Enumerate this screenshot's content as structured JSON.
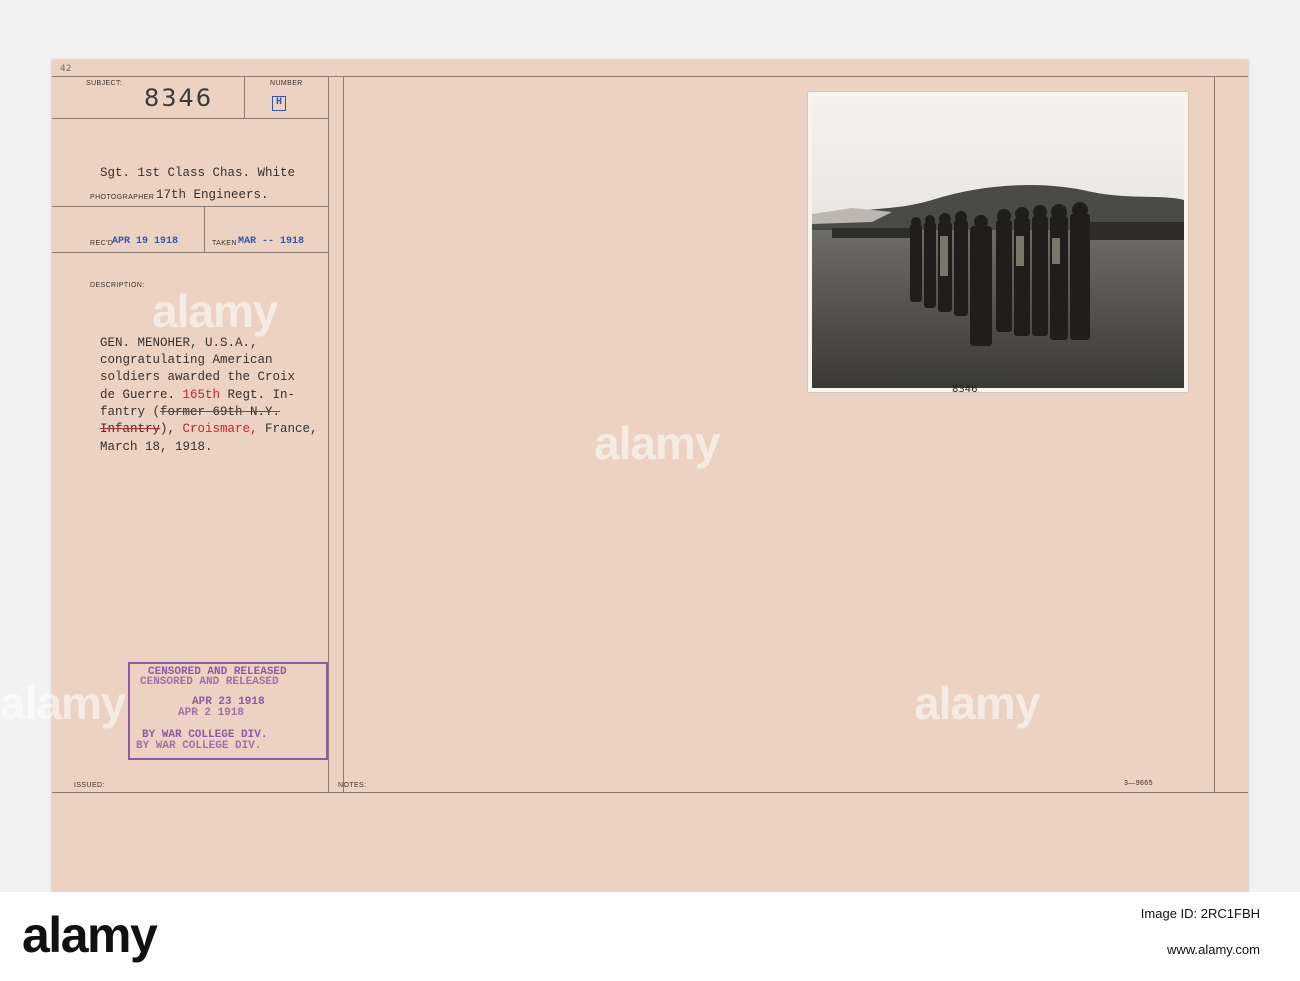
{
  "card": {
    "corner_note": "42",
    "subject_label": "SUBJECT:",
    "subject_value": "8346",
    "number_label": "NUMBER",
    "number_value": "H",
    "photographer_line1": "Sgt. 1st Class Chas. White",
    "photographer_label": "PHOTOGRAPHER",
    "photographer_line2": "17th Engineers.",
    "recd_label": "REC'D",
    "recd_date": "APR 19 1918",
    "taken_label": "TAKEN",
    "taken_date": "MAR -- 1918",
    "description_label": "DESCRIPTION:",
    "description": {
      "l1": "GEN. MENOHER, U.S.A.,",
      "l2": "congratulating American",
      "l3": "soldiers awarded the Croix",
      "l4_pre": "de Guerre. ",
      "l4_red": "165th",
      "l4_post": " Regt. In-",
      "l5_pre": "fantry (",
      "l5_strike": "former 69th N.Y.",
      "l6_strike": "Infantry",
      "l6_mid": "), ",
      "l6_red": "Croismare,",
      "l6_post": " France,",
      "l7": "March 18, 1918."
    },
    "stamp": {
      "line1": "CENSORED AND RELEASED",
      "line2": "CENSORED AND RELEASED",
      "line3": "APR 23 1918",
      "line4": "APR 2 1918",
      "line5": "BY WAR COLLEGE DIV.",
      "line6": "BY WAR COLLEGE DIV."
    },
    "issued_label": "ISSUED:",
    "notes_label": "NOTES:",
    "form_code": "3—9665",
    "photo_caption": "8346"
  },
  "watermark": "alamy",
  "footer": {
    "logo": "alamy",
    "image_id": "Image ID: 2RC1FBH",
    "site": "www.alamy.com"
  }
}
